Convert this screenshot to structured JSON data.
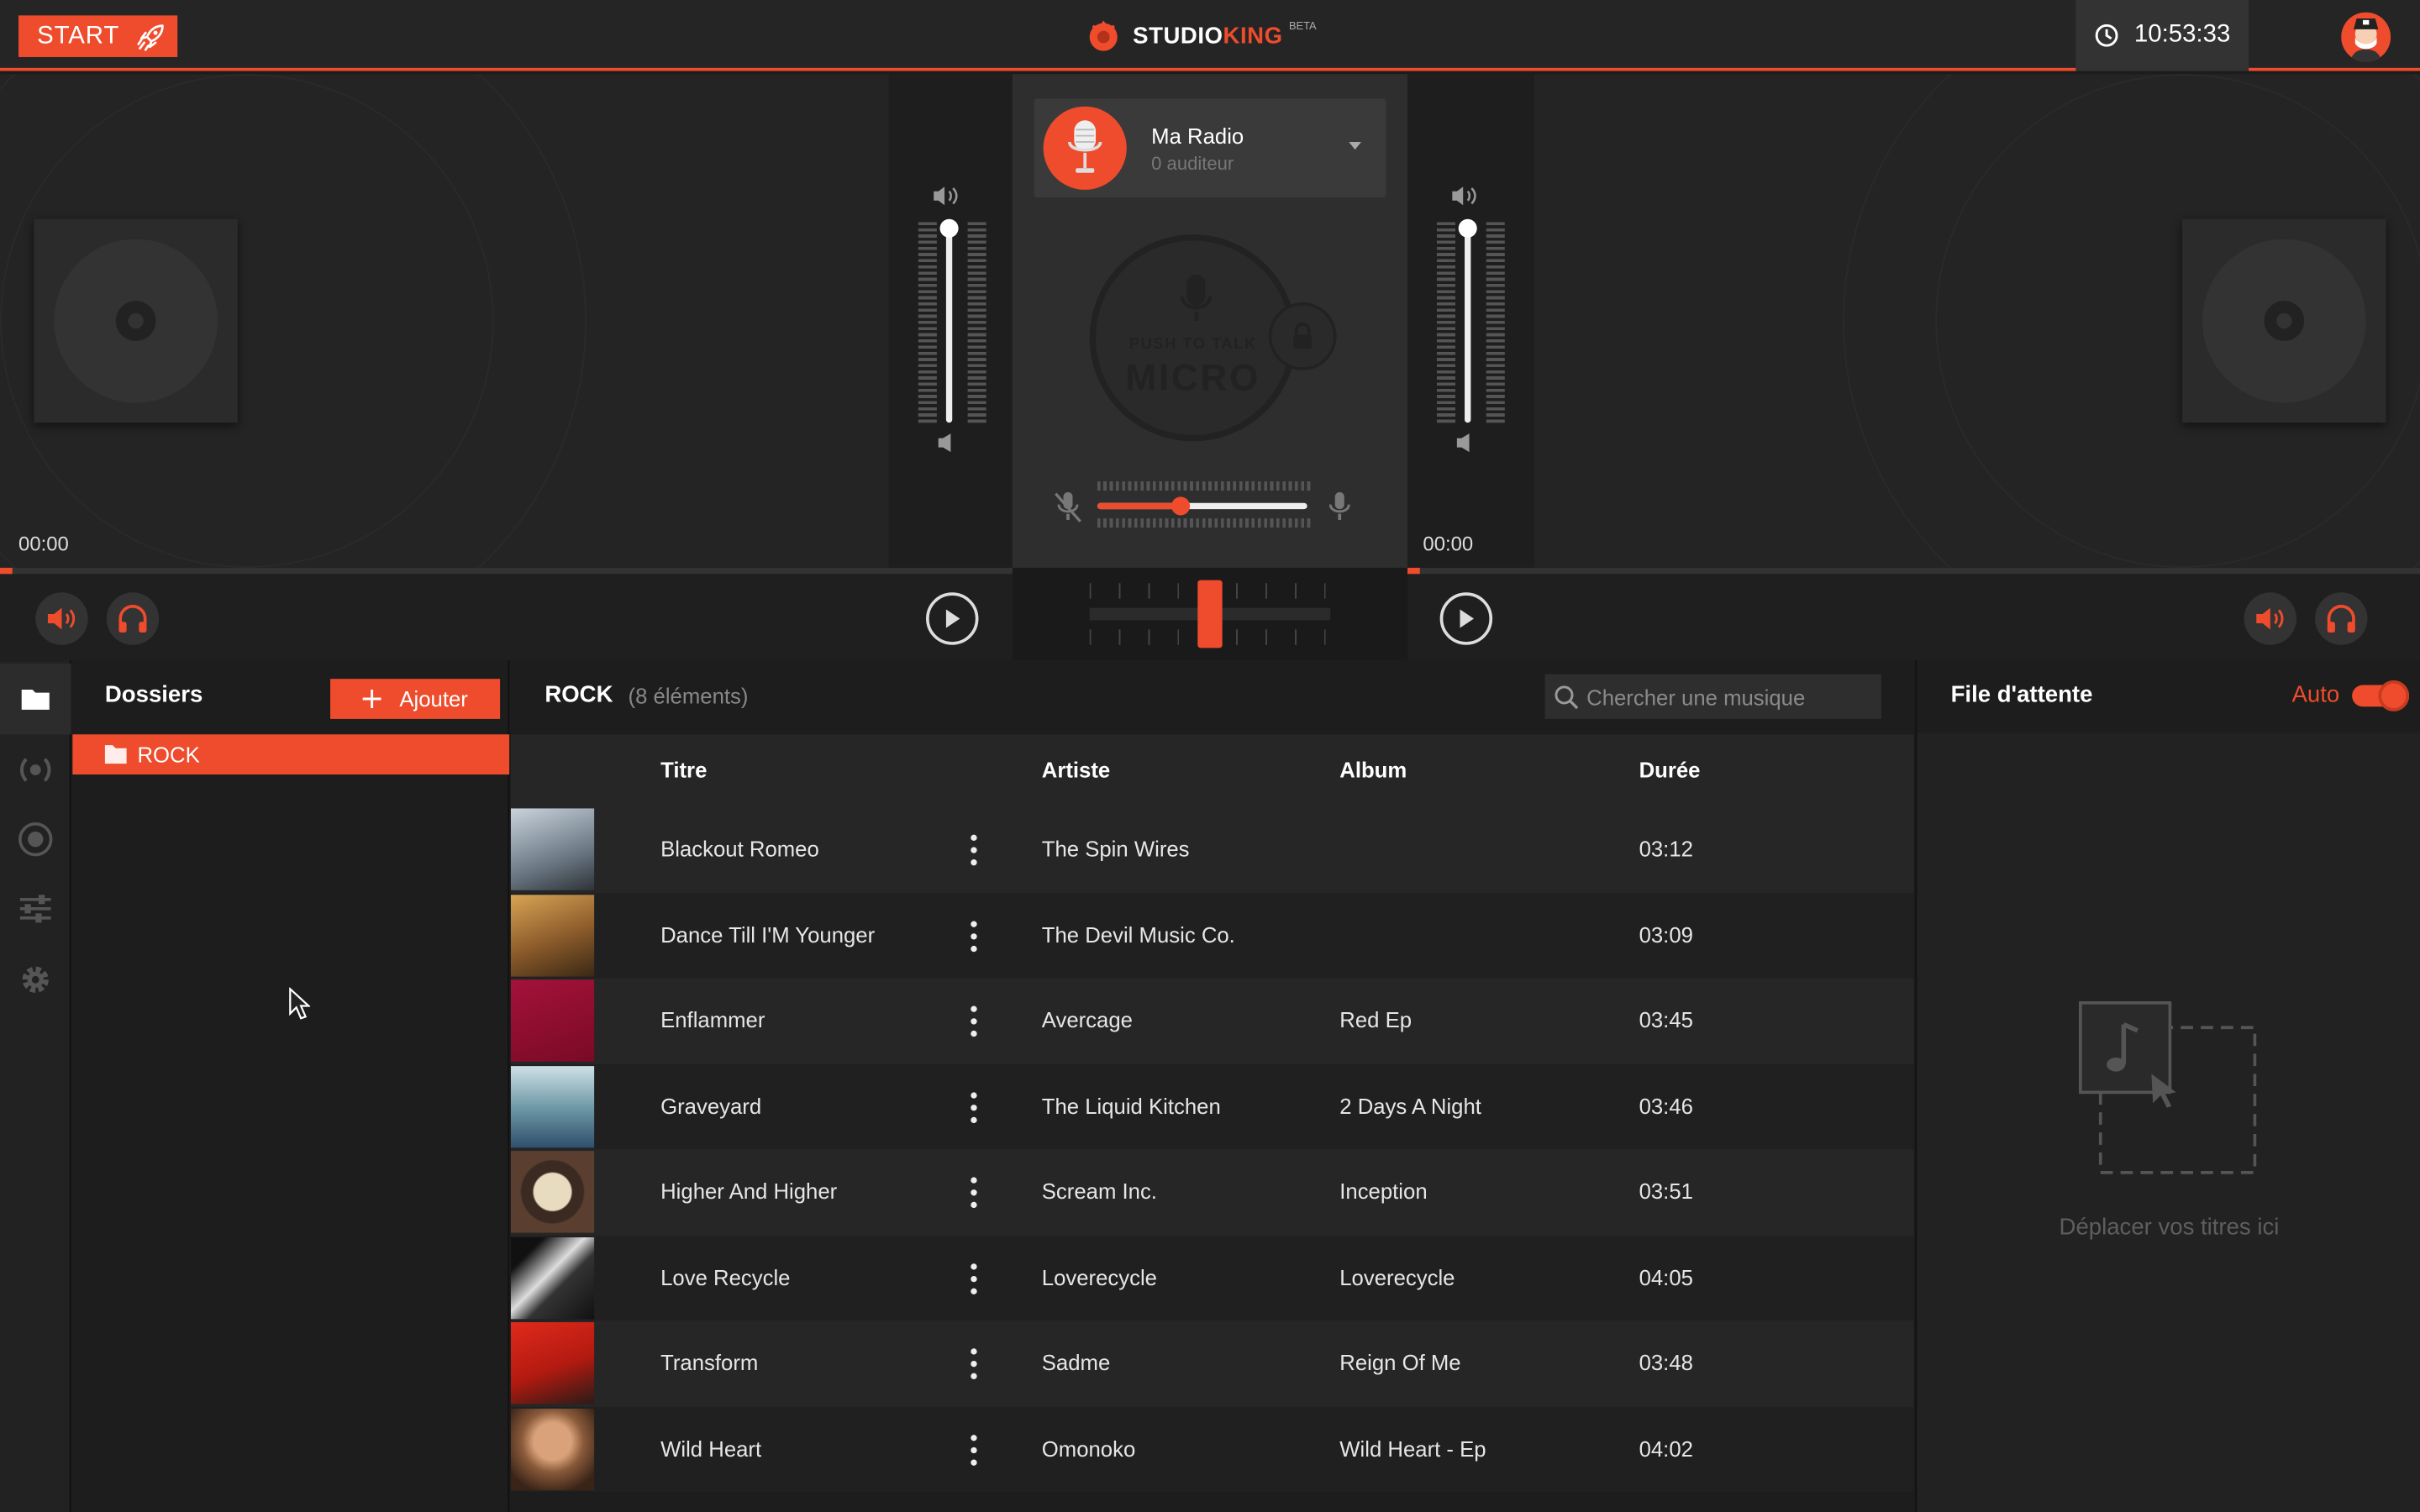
{
  "topbar": {
    "start_label": "START",
    "brand_part1": "STUDIO",
    "brand_part2": "KING",
    "brand_badge": "BETA",
    "clock": "10:53:33",
    "accent": "#ee4c2c"
  },
  "decks": {
    "left_time": "00:00",
    "right_time": "00:00"
  },
  "station": {
    "name": "Ma Radio",
    "listeners": "0 auditeur",
    "push_to_talk": "PUSH TO TALK",
    "micro": "MICRO",
    "mic_volume_percent": 40,
    "crossfader_percent": 50
  },
  "folders": {
    "title": "Dossiers",
    "add_label": "Ajouter",
    "items": [
      {
        "label": "ROCK",
        "selected": true
      }
    ]
  },
  "library": {
    "title": "ROCK",
    "count": "(8 éléments)",
    "search_placeholder": "Chercher une musique",
    "columns": {
      "title": "Titre",
      "artist": "Artiste",
      "album": "Album",
      "duration": "Durée"
    },
    "tracks": [
      {
        "title": "Blackout Romeo",
        "artist": "The Spin Wires",
        "album": "",
        "duration": "03:12"
      },
      {
        "title": "Dance Till I'M Younger",
        "artist": "The Devil Music Co.",
        "album": "",
        "duration": "03:09"
      },
      {
        "title": "Enflammer",
        "artist": "Avercage",
        "album": "Red Ep",
        "duration": "03:45"
      },
      {
        "title": "Graveyard",
        "artist": "The Liquid Kitchen",
        "album": "2 Days A Night",
        "duration": "03:46"
      },
      {
        "title": "Higher And Higher",
        "artist": "Scream Inc.",
        "album": "Inception",
        "duration": "03:51"
      },
      {
        "title": "Love Recycle",
        "artist": "Loverecycle",
        "album": "Loverecycle",
        "duration": "04:05"
      },
      {
        "title": "Transform",
        "artist": "Sadme",
        "album": "Reign Of Me",
        "duration": "03:48"
      },
      {
        "title": "Wild Heart",
        "artist": "Omonoko",
        "album": "Wild Heart - Ep",
        "duration": "04:02"
      }
    ]
  },
  "queue": {
    "title": "File d'attente",
    "auto_label": "Auto",
    "auto_enabled": true,
    "drop_hint": "Déplacer vos titres ici"
  }
}
